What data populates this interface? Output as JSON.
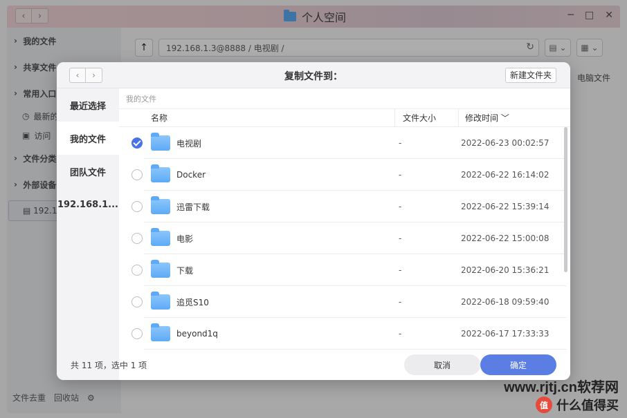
{
  "app": {
    "title": "个人空间",
    "sidebar": {
      "my_files": "我的文件",
      "shared_files": "共享文件",
      "common_entry": "常用入口",
      "recent": "最新的",
      "visited": "访问",
      "file_category": "文件分类",
      "external": "外部设备",
      "ip_item": "192.1"
    },
    "address": "192.168.1.3@8888 / 电视剧 /",
    "pc_file": "电脑文件",
    "bottom": {
      "dedupe": "文件去重",
      "recycle": "回收站"
    }
  },
  "dialog": {
    "title": "复制文件到：",
    "new_folder": "新建文件夹",
    "sidebar": [
      {
        "label": "最近选择",
        "active": false
      },
      {
        "label": "我的文件",
        "active": true
      },
      {
        "label": "团队文件",
        "active": false
      },
      {
        "label": "192.168.1...",
        "active": false
      }
    ],
    "breadcrumb": "我的文件",
    "columns": {
      "name": "名称",
      "size": "文件大小",
      "time": "修改时间 ﹀"
    },
    "rows": [
      {
        "name": "电视剧",
        "size": "-",
        "time": "2022-06-23 00:02:57",
        "selected": true
      },
      {
        "name": "Docker",
        "size": "-",
        "time": "2022-06-22 16:14:02",
        "selected": false
      },
      {
        "name": "迅雷下载",
        "size": "-",
        "time": "2022-06-22 15:39:14",
        "selected": false
      },
      {
        "name": "电影",
        "size": "-",
        "time": "2022-06-22 15:00:08",
        "selected": false
      },
      {
        "name": "下载",
        "size": "-",
        "time": "2022-06-20 15:36:21",
        "selected": false
      },
      {
        "name": "追觅S10",
        "size": "-",
        "time": "2022-06-18 09:59:40",
        "selected": false
      },
      {
        "name": "beyond1q",
        "size": "-",
        "time": "2022-06-17 17:33:33",
        "selected": false
      }
    ],
    "footer": {
      "count": "共 11 项，选中 1 项",
      "cancel": "取消",
      "ok": "确定"
    }
  },
  "watermark": {
    "line1": "www.rjtj.cn软荐网",
    "line2": "什么值得买",
    "logo": "值"
  }
}
